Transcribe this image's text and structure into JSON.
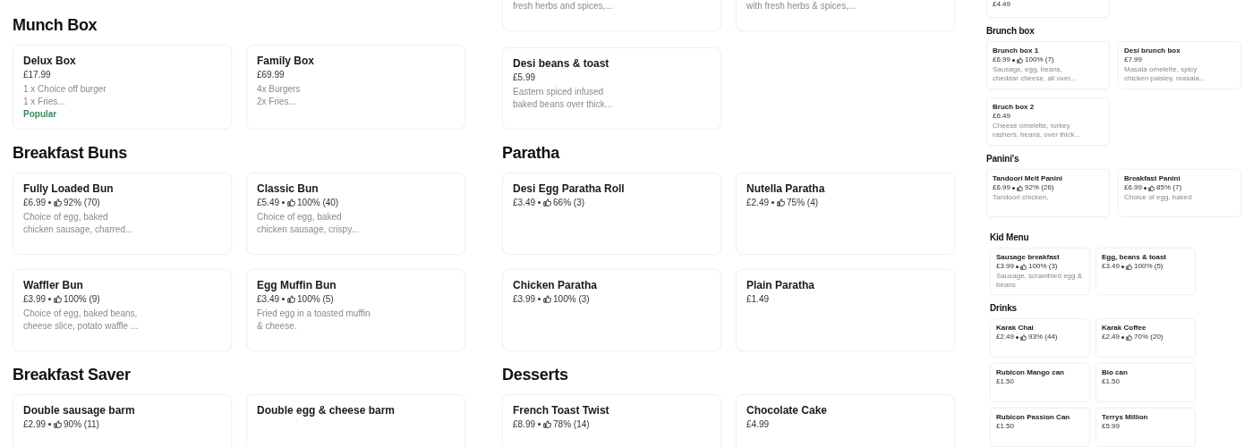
{
  "panels": [
    {
      "sections": [
        {
          "title": "Munch Box",
          "items": [
            {
              "kind": "item",
              "name": "Delux Box",
              "price": "£17.99",
              "description": [
                "1 x Choice off burger",
                "1 x Fries..."
              ],
              "badge": "Popular"
            },
            {
              "kind": "item",
              "name": "Family Box",
              "price": "£69.99",
              "description": [
                "4x Burgers",
                "2x Fries..."
              ]
            }
          ]
        },
        {
          "title": "Breakfast Buns",
          "items": [
            {
              "kind": "item",
              "name": "Fully Loaded Bun",
              "price": "£6.99",
              "rating": "92% (70)",
              "description": [
                "Choice of egg, baked",
                "chicken sausage, charred..."
              ]
            },
            {
              "kind": "item",
              "name": "Classic Bun",
              "price": "£5.49",
              "rating": "100% (40)",
              "description": [
                "Choice of egg, baked",
                "chicken sausage, crispy..."
              ]
            },
            {
              "kind": "item",
              "name": "Waffler Bun",
              "price": "£3.99",
              "rating": "100% (9)",
              "description": [
                "Choice of egg, baked beans,",
                "cheese slice, potato waffle ..."
              ]
            },
            {
              "kind": "item",
              "name": "Egg Muffin Bun",
              "price": "£3.49",
              "rating": "100% (5)",
              "description": [
                "Fried egg in a toasted muffin",
                "& cheese."
              ]
            }
          ]
        },
        {
          "title": "Breakfast Saver",
          "items": [
            {
              "kind": "item",
              "name": "Double sausage barm",
              "price": "£2.99",
              "rating": "90% (11)"
            },
            {
              "kind": "item",
              "name": "Double egg & cheese barm"
            }
          ]
        }
      ]
    },
    {
      "sections": [
        {
          "items": [
            {
              "kind": "fragment",
              "description": [
                "fresh herbs and spices,..."
              ]
            },
            {
              "kind": "fragment",
              "description": [
                "with fresh herbs & spices,..."
              ]
            },
            {
              "kind": "item",
              "name": "Desi beans & toast",
              "price": "£5.99",
              "description": [
                "Eastern spiced infused",
                "baked beans over thick..."
              ]
            }
          ]
        },
        {
          "title": "Paratha",
          "items": [
            {
              "kind": "item",
              "name": "Desi Egg Paratha Roll",
              "price": "£3.49",
              "rating": "66% (3)"
            },
            {
              "kind": "item",
              "name": "Nutella Paratha",
              "price": "£2.49",
              "rating": "75% (4)"
            },
            {
              "kind": "item",
              "name": "Chicken Paratha",
              "price": "£3.99",
              "rating": "100% (3)"
            },
            {
              "kind": "item",
              "name": "Plain Paratha",
              "price": "£1.49"
            }
          ]
        },
        {
          "title": "Desserts",
          "items": [
            {
              "kind": "item",
              "name": "French Toast Twist",
              "price": "£8.99",
              "rating": "78% (14)"
            },
            {
              "kind": "item",
              "name": "Chocolate Cake",
              "price": "£4.99"
            }
          ]
        }
      ]
    },
    {
      "sections": [
        {
          "items": [
            {
              "kind": "fragment",
              "price": "£4.49"
            }
          ]
        },
        {
          "title": "Brunch box",
          "items": [
            {
              "kind": "item",
              "name": "Brunch box 1",
              "price": "£6.99",
              "rating": "100% (7)",
              "description": [
                "Sausage, egg, beans,",
                "cheddar cheese, all over..."
              ]
            },
            {
              "kind": "item",
              "name": "Desi brunch box",
              "price": "£7.99",
              "description": [
                "Masala omelette, spicy",
                "chicken paisley, masala..."
              ]
            },
            {
              "kind": "item",
              "name": "Bruch box 2",
              "price": "£6.49",
              "description": [
                "Cheese omelette, turkey",
                "rashers, beans, over thick..."
              ]
            }
          ]
        },
        {
          "title": "Panini's",
          "items": [
            {
              "kind": "item",
              "name": "Tandoori Melt Panini",
              "price": "£6.99",
              "rating": "92% (26)",
              "description": [
                "Tandoori chicken,"
              ]
            },
            {
              "kind": "item",
              "name": "Breakfast Panini",
              "price": "£6.99",
              "rating": "85% (7)",
              "description": [
                "Choice of egg, baked"
              ]
            }
          ]
        }
      ]
    },
    {
      "sections": [
        {
          "title": "Kid Menu",
          "items": [
            {
              "kind": "item",
              "name": "Sausage breakfast",
              "price": "£3.99",
              "rating": "100% (3)",
              "description": [
                "Sausage, scrambled egg &",
                "beans"
              ]
            },
            {
              "kind": "item",
              "name": "Egg, beans & toast",
              "price": "£3.49",
              "rating": "100% (5)"
            }
          ]
        },
        {
          "title": "Drinks",
          "items": [
            {
              "kind": "item",
              "name": "Karak Chai",
              "price": "£2.49",
              "rating": "93% (44)"
            },
            {
              "kind": "item",
              "name": "Karak Coffee",
              "price": "£2.49",
              "rating": "70% (20)"
            },
            {
              "kind": "item",
              "name": "Rubicon Mango can",
              "price": "£1.50"
            },
            {
              "kind": "item",
              "name": "Bio can",
              "price": "£1.50"
            },
            {
              "kind": "item",
              "name": "Rubicon Passion Can",
              "price": "£1.50"
            },
            {
              "kind": "item",
              "name": "Terrys Million",
              "price": "£5.99"
            }
          ]
        }
      ]
    }
  ]
}
